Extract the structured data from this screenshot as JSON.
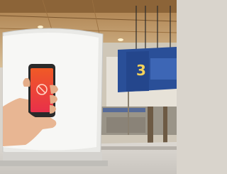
{
  "gate_sign": {
    "number": "3"
  },
  "colors": {
    "ceiling": "#b58a55",
    "floor": "#d6d2cc",
    "billboard_frame": "#eeeeec",
    "billboard_screen": "#f6f6f4",
    "sign_blue": "#2a4f98",
    "phone_screen": "#ef4a2a"
  }
}
